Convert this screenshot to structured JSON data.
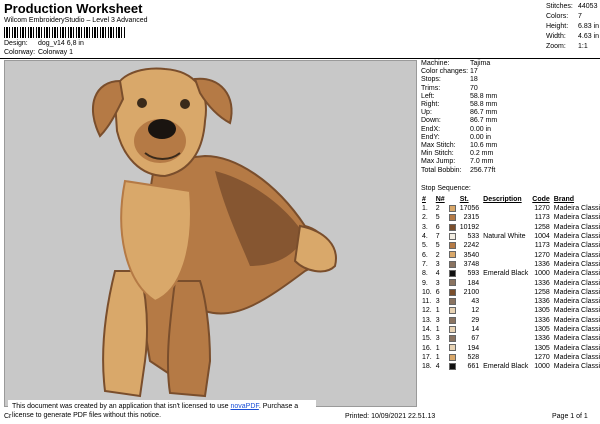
{
  "header": {
    "title": "Production Worksheet",
    "subtitle": "Wilcom EmbroideryStudio – Level 3 Advanced",
    "design_label": "Design:",
    "design_value": "dog_v14 6,8 in",
    "colorway_label": "Colorway:",
    "colorway_value": "Colorway 1"
  },
  "summary": [
    {
      "k": "Stitches:",
      "v": "44053"
    },
    {
      "k": "Colors:",
      "v": "7"
    },
    {
      "k": "Height:",
      "v": "6.83 in"
    },
    {
      "k": "Width:",
      "v": "4.63 in"
    },
    {
      "k": "Zoom:",
      "v": "1:1"
    }
  ],
  "machine_info": [
    {
      "k": "Machine:",
      "v": "Tajima"
    },
    {
      "k": "Color changes:",
      "v": "17"
    },
    {
      "k": "Stops:",
      "v": "18"
    },
    {
      "k": "Trims:",
      "v": "70"
    },
    {
      "k": "Left:",
      "v": "58.8 mm"
    },
    {
      "k": "Right:",
      "v": "58.8 mm"
    },
    {
      "k": "Up:",
      "v": "86.7 mm"
    },
    {
      "k": "Down:",
      "v": "86.7 mm"
    },
    {
      "k": "EndX:",
      "v": "0.00 in"
    },
    {
      "k": "EndY:",
      "v": "0.00 in"
    },
    {
      "k": "Max Stitch:",
      "v": "10.6 mm"
    },
    {
      "k": "Min Stitch:",
      "v": "0.2 mm"
    },
    {
      "k": "Max Jump:",
      "v": "7.0 mm"
    },
    {
      "k": "Total Bobbin:",
      "v": "256.77ft"
    }
  ],
  "sequence": {
    "title": "Stop Sequence:",
    "headers": [
      "#",
      "N#",
      "St.",
      "Description",
      "Code",
      "Brand"
    ],
    "rows": [
      {
        "n": "1.",
        "needle": "2",
        "color": "#d9a86a",
        "st": "17056",
        "desc": "",
        "code": "1270",
        "brand": "Madeira Classic 40"
      },
      {
        "n": "2.",
        "needle": "5",
        "color": "#b57a45",
        "st": "2315",
        "desc": "",
        "code": "1173",
        "brand": "Madeira Classic 40"
      },
      {
        "n": "3.",
        "needle": "6",
        "color": "#7a4e2c",
        "st": "10192",
        "desc": "",
        "code": "1258",
        "brand": "Madeira Classic 40"
      },
      {
        "n": "4.",
        "needle": "7",
        "color": "#f2ede2",
        "st": "533",
        "desc": "Natural White",
        "code": "1004",
        "brand": "Madeira Classic 40"
      },
      {
        "n": "5.",
        "needle": "5",
        "color": "#b57a45",
        "st": "2242",
        "desc": "",
        "code": "1173",
        "brand": "Madeira Classic 40"
      },
      {
        "n": "6.",
        "needle": "2",
        "color": "#d9a86a",
        "st": "3540",
        "desc": "",
        "code": "1270",
        "brand": "Madeira Classic 40"
      },
      {
        "n": "7.",
        "needle": "3",
        "color": "#8a7360",
        "st": "3748",
        "desc": "",
        "code": "1336",
        "brand": "Madeira Classic 40"
      },
      {
        "n": "8.",
        "needle": "4",
        "color": "#111111",
        "st": "593",
        "desc": "Emerald Black",
        "code": "1000",
        "brand": "Madeira Classic 40"
      },
      {
        "n": "9.",
        "needle": "3",
        "color": "#8a7360",
        "st": "184",
        "desc": "",
        "code": "1336",
        "brand": "Madeira Classic 40"
      },
      {
        "n": "10.",
        "needle": "6",
        "color": "#7a4e2c",
        "st": "2100",
        "desc": "",
        "code": "1258",
        "brand": "Madeira Classic 40"
      },
      {
        "n": "11.",
        "needle": "3",
        "color": "#8a7360",
        "st": "43",
        "desc": "",
        "code": "1336",
        "brand": "Madeira Classic 40"
      },
      {
        "n": "12.",
        "needle": "1",
        "color": "#e8d3b4",
        "st": "12",
        "desc": "",
        "code": "1305",
        "brand": "Madeira Classic 40"
      },
      {
        "n": "13.",
        "needle": "3",
        "color": "#8a7360",
        "st": "29",
        "desc": "",
        "code": "1336",
        "brand": "Madeira Classic 40"
      },
      {
        "n": "14.",
        "needle": "1",
        "color": "#e8d3b4",
        "st": "14",
        "desc": "",
        "code": "1305",
        "brand": "Madeira Classic 40"
      },
      {
        "n": "15.",
        "needle": "3",
        "color": "#8a7360",
        "st": "67",
        "desc": "",
        "code": "1336",
        "brand": "Madeira Classic 40"
      },
      {
        "n": "16.",
        "needle": "1",
        "color": "#e8d3b4",
        "st": "194",
        "desc": "",
        "code": "1305",
        "brand": "Madeira Classic 40"
      },
      {
        "n": "17.",
        "needle": "1",
        "color": "#d9a86a",
        "st": "528",
        "desc": "",
        "code": "1270",
        "brand": "Madeira Classic 40"
      },
      {
        "n": "18.",
        "needle": "4",
        "color": "#111111",
        "st": "661",
        "desc": "Emerald Black",
        "code": "1000",
        "brand": "Madeira Classic 40"
      }
    ]
  },
  "notice": {
    "text": "This document was created by an application that isn't licensed to use ",
    "link": "novaPDF",
    "text2": ". Purchase a license to generate PDF files without this notice."
  },
  "footer": {
    "left": "Cr",
    "printed": "Printed: 10/09/2021 22.51.13",
    "page": "Page 1 of 1"
  },
  "colors": {
    "preview_bg": "#c8c8c8",
    "dog_light": "#d9a86a",
    "dog_mid": "#b57a45",
    "dog_dark": "#7a4e2c",
    "nose": "#1a1410"
  }
}
